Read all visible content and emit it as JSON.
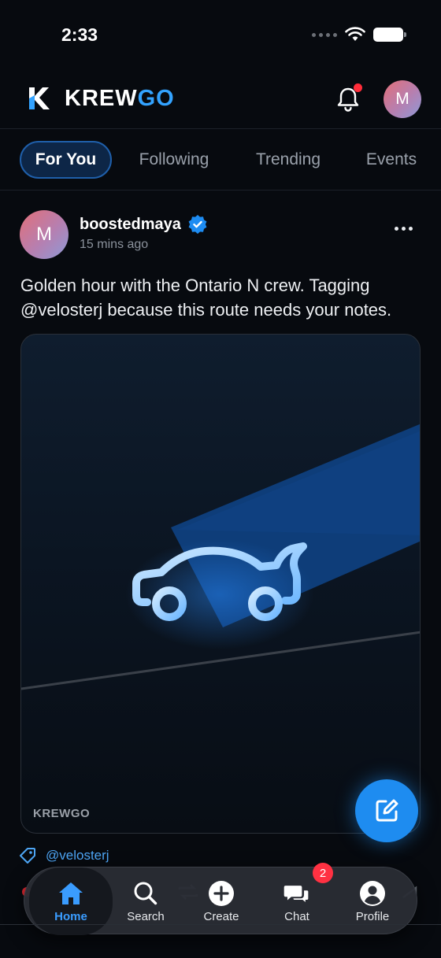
{
  "status_bar": {
    "time": "2:33"
  },
  "app": {
    "brand_a": "KREW",
    "brand_b": "GO",
    "brand_color": "#33a3ff",
    "avatar_initial": "M"
  },
  "tabs": [
    {
      "label": "For You",
      "active": true
    },
    {
      "label": "Following",
      "active": false
    },
    {
      "label": "Trending",
      "active": false
    },
    {
      "label": "Events",
      "active": false
    }
  ],
  "post": {
    "avatar_initial": "M",
    "username": "boostedmaya",
    "verified": true,
    "time_ago": "15 mins ago",
    "text": "Golden hour with the Ontario N crew. Tagging @velosterj because this route needs your notes.",
    "media_watermark": "KREWGO",
    "tagged_user": "@velosterj"
  },
  "bottom_nav": [
    {
      "label": "Home",
      "icon": "home-icon",
      "active": true
    },
    {
      "label": "Search",
      "icon": "search-icon",
      "active": false
    },
    {
      "label": "Create",
      "icon": "plus-circle-icon",
      "active": false
    },
    {
      "label": "Chat",
      "icon": "chat-icon",
      "active": false,
      "badge": "2"
    },
    {
      "label": "Profile",
      "icon": "user-icon",
      "active": false
    }
  ],
  "colors": {
    "accent": "#1e8cf0",
    "badge": "#ff3142",
    "background": "#070a0f"
  }
}
